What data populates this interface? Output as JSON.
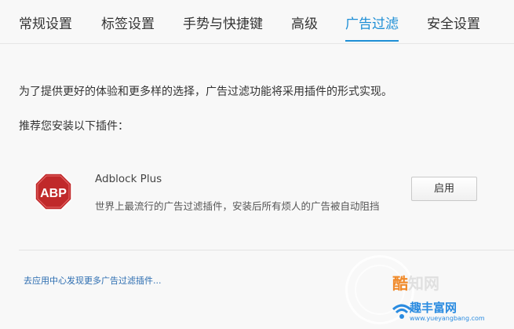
{
  "tabs": [
    {
      "label": "常规设置",
      "active": false
    },
    {
      "label": "标签设置",
      "active": false
    },
    {
      "label": "手势与快捷键",
      "active": false
    },
    {
      "label": "高级",
      "active": false
    },
    {
      "label": "广告过滤",
      "active": true
    },
    {
      "label": "安全设置",
      "active": false
    }
  ],
  "content": {
    "intro": "为了提供更好的体验和更多样的选择，广告过滤功能将采用插件的形式实现。",
    "recommend": "推荐您安装以下插件："
  },
  "plugin": {
    "logo_text": "ABP",
    "name": "Adblock Plus",
    "description": "世界上最流行的广告过滤插件，安装后所有烦人的广告被自动阻挡",
    "button_label": "启用"
  },
  "footer": {
    "store_link": "去应用中心发现更多广告过滤插件..."
  },
  "watermark": {
    "logo1_prefix": "酷",
    "logo1_rest": "知网",
    "logo2": "趣丰富网",
    "url": "www.yueyangbang.com"
  },
  "colors": {
    "accent": "#1e8fd6",
    "abp_red": "#c0292a",
    "link": "#2b6cb0"
  }
}
